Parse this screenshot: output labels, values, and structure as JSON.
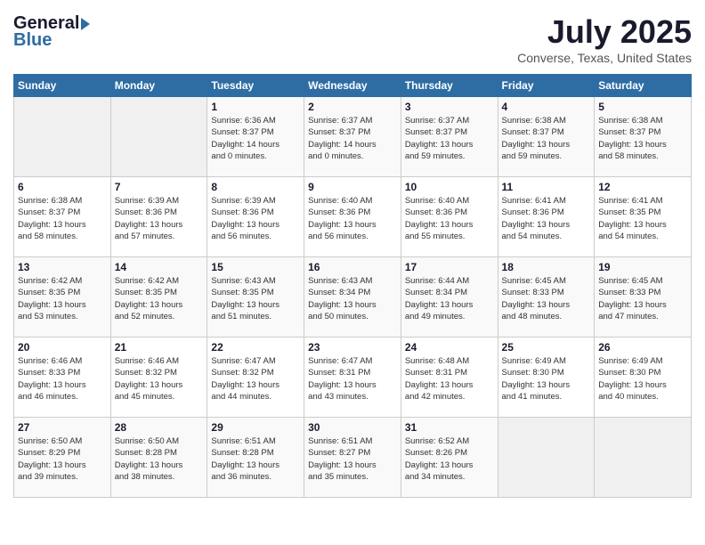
{
  "header": {
    "logo_general": "General",
    "logo_blue": "Blue",
    "month_year": "July 2025",
    "location": "Converse, Texas, United States"
  },
  "weekdays": [
    "Sunday",
    "Monday",
    "Tuesday",
    "Wednesday",
    "Thursday",
    "Friday",
    "Saturday"
  ],
  "weeks": [
    [
      {
        "day": "",
        "info": ""
      },
      {
        "day": "",
        "info": ""
      },
      {
        "day": "1",
        "info": "Sunrise: 6:36 AM\nSunset: 8:37 PM\nDaylight: 14 hours\nand 0 minutes."
      },
      {
        "day": "2",
        "info": "Sunrise: 6:37 AM\nSunset: 8:37 PM\nDaylight: 14 hours\nand 0 minutes."
      },
      {
        "day": "3",
        "info": "Sunrise: 6:37 AM\nSunset: 8:37 PM\nDaylight: 13 hours\nand 59 minutes."
      },
      {
        "day": "4",
        "info": "Sunrise: 6:38 AM\nSunset: 8:37 PM\nDaylight: 13 hours\nand 59 minutes."
      },
      {
        "day": "5",
        "info": "Sunrise: 6:38 AM\nSunset: 8:37 PM\nDaylight: 13 hours\nand 58 minutes."
      }
    ],
    [
      {
        "day": "6",
        "info": "Sunrise: 6:38 AM\nSunset: 8:37 PM\nDaylight: 13 hours\nand 58 minutes."
      },
      {
        "day": "7",
        "info": "Sunrise: 6:39 AM\nSunset: 8:36 PM\nDaylight: 13 hours\nand 57 minutes."
      },
      {
        "day": "8",
        "info": "Sunrise: 6:39 AM\nSunset: 8:36 PM\nDaylight: 13 hours\nand 56 minutes."
      },
      {
        "day": "9",
        "info": "Sunrise: 6:40 AM\nSunset: 8:36 PM\nDaylight: 13 hours\nand 56 minutes."
      },
      {
        "day": "10",
        "info": "Sunrise: 6:40 AM\nSunset: 8:36 PM\nDaylight: 13 hours\nand 55 minutes."
      },
      {
        "day": "11",
        "info": "Sunrise: 6:41 AM\nSunset: 8:36 PM\nDaylight: 13 hours\nand 54 minutes."
      },
      {
        "day": "12",
        "info": "Sunrise: 6:41 AM\nSunset: 8:35 PM\nDaylight: 13 hours\nand 54 minutes."
      }
    ],
    [
      {
        "day": "13",
        "info": "Sunrise: 6:42 AM\nSunset: 8:35 PM\nDaylight: 13 hours\nand 53 minutes."
      },
      {
        "day": "14",
        "info": "Sunrise: 6:42 AM\nSunset: 8:35 PM\nDaylight: 13 hours\nand 52 minutes."
      },
      {
        "day": "15",
        "info": "Sunrise: 6:43 AM\nSunset: 8:35 PM\nDaylight: 13 hours\nand 51 minutes."
      },
      {
        "day": "16",
        "info": "Sunrise: 6:43 AM\nSunset: 8:34 PM\nDaylight: 13 hours\nand 50 minutes."
      },
      {
        "day": "17",
        "info": "Sunrise: 6:44 AM\nSunset: 8:34 PM\nDaylight: 13 hours\nand 49 minutes."
      },
      {
        "day": "18",
        "info": "Sunrise: 6:45 AM\nSunset: 8:33 PM\nDaylight: 13 hours\nand 48 minutes."
      },
      {
        "day": "19",
        "info": "Sunrise: 6:45 AM\nSunset: 8:33 PM\nDaylight: 13 hours\nand 47 minutes."
      }
    ],
    [
      {
        "day": "20",
        "info": "Sunrise: 6:46 AM\nSunset: 8:33 PM\nDaylight: 13 hours\nand 46 minutes."
      },
      {
        "day": "21",
        "info": "Sunrise: 6:46 AM\nSunset: 8:32 PM\nDaylight: 13 hours\nand 45 minutes."
      },
      {
        "day": "22",
        "info": "Sunrise: 6:47 AM\nSunset: 8:32 PM\nDaylight: 13 hours\nand 44 minutes."
      },
      {
        "day": "23",
        "info": "Sunrise: 6:47 AM\nSunset: 8:31 PM\nDaylight: 13 hours\nand 43 minutes."
      },
      {
        "day": "24",
        "info": "Sunrise: 6:48 AM\nSunset: 8:31 PM\nDaylight: 13 hours\nand 42 minutes."
      },
      {
        "day": "25",
        "info": "Sunrise: 6:49 AM\nSunset: 8:30 PM\nDaylight: 13 hours\nand 41 minutes."
      },
      {
        "day": "26",
        "info": "Sunrise: 6:49 AM\nSunset: 8:30 PM\nDaylight: 13 hours\nand 40 minutes."
      }
    ],
    [
      {
        "day": "27",
        "info": "Sunrise: 6:50 AM\nSunset: 8:29 PM\nDaylight: 13 hours\nand 39 minutes."
      },
      {
        "day": "28",
        "info": "Sunrise: 6:50 AM\nSunset: 8:28 PM\nDaylight: 13 hours\nand 38 minutes."
      },
      {
        "day": "29",
        "info": "Sunrise: 6:51 AM\nSunset: 8:28 PM\nDaylight: 13 hours\nand 36 minutes."
      },
      {
        "day": "30",
        "info": "Sunrise: 6:51 AM\nSunset: 8:27 PM\nDaylight: 13 hours\nand 35 minutes."
      },
      {
        "day": "31",
        "info": "Sunrise: 6:52 AM\nSunset: 8:26 PM\nDaylight: 13 hours\nand 34 minutes."
      },
      {
        "day": "",
        "info": ""
      },
      {
        "day": "",
        "info": ""
      }
    ]
  ]
}
